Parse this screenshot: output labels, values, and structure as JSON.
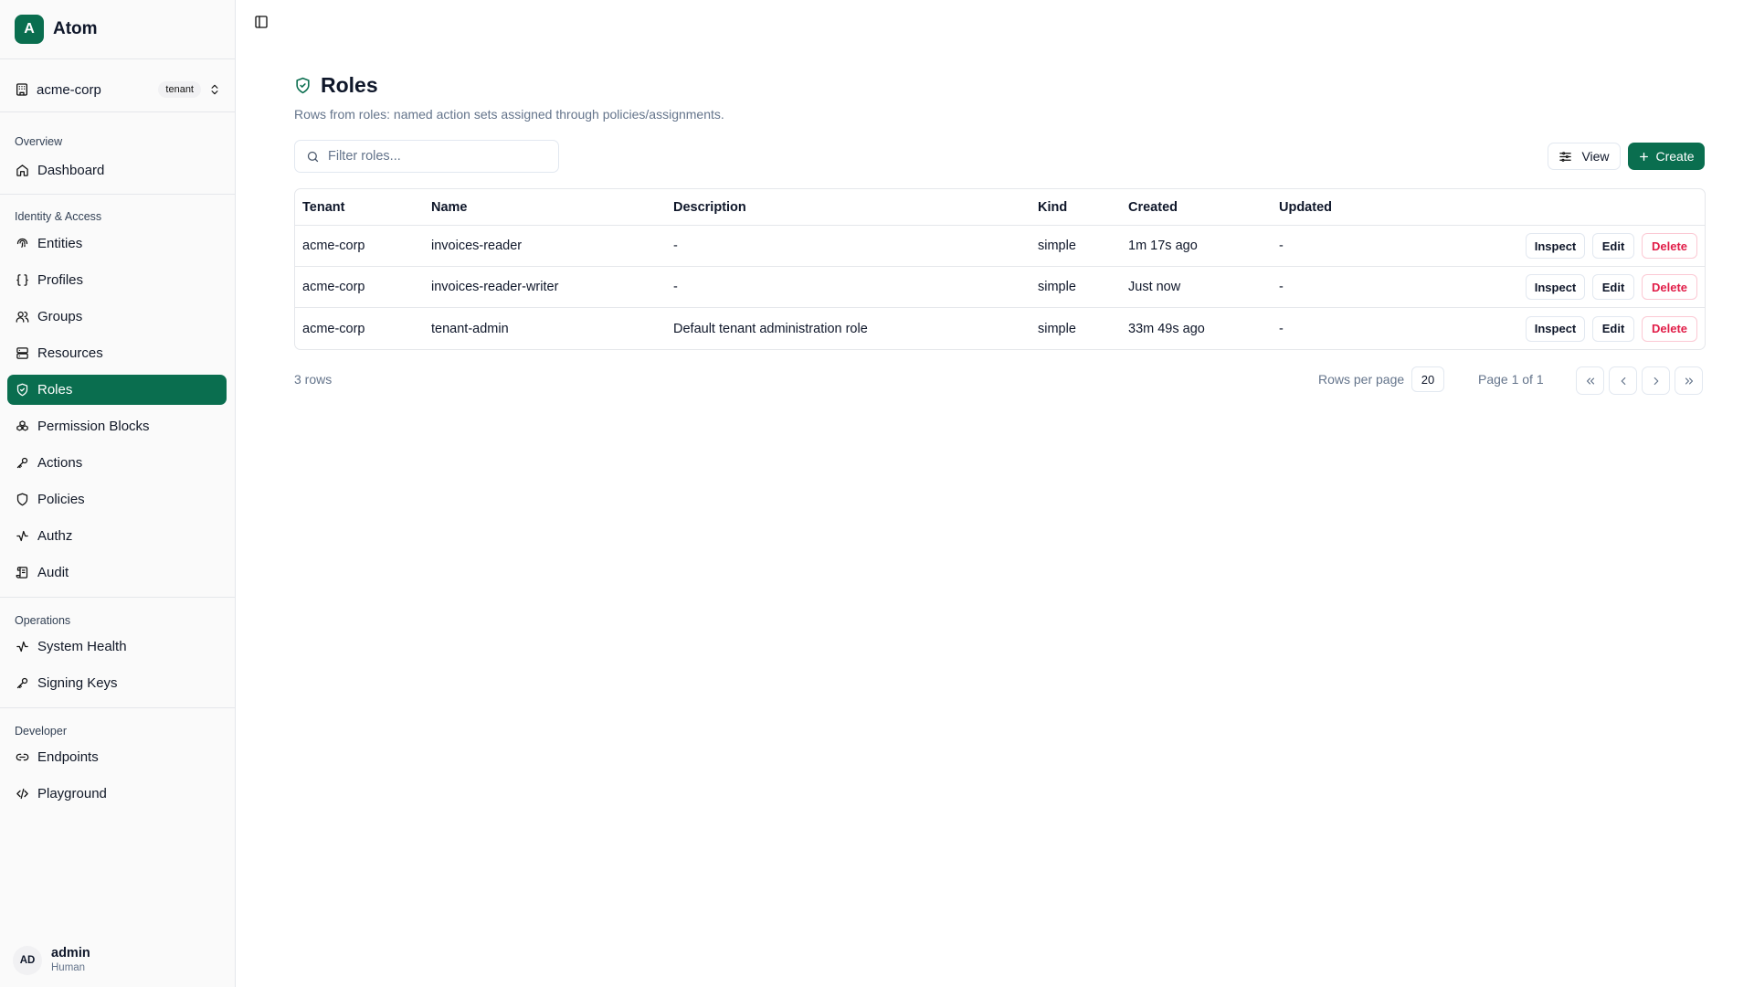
{
  "brand": {
    "logo_letter": "A",
    "name": "Atom"
  },
  "tenant": {
    "name": "acme-corp",
    "badge": "tenant"
  },
  "sidebar": {
    "sections": [
      {
        "label": "Overview",
        "items": [
          {
            "label": "Dashboard",
            "icon": "home-icon"
          }
        ]
      },
      {
        "label": "Identity & Access",
        "items": [
          {
            "label": "Entities",
            "icon": "fingerprint-icon"
          },
          {
            "label": "Profiles",
            "icon": "braces-icon"
          },
          {
            "label": "Groups",
            "icon": "users-icon"
          },
          {
            "label": "Resources",
            "icon": "server-icon"
          },
          {
            "label": "Roles",
            "icon": "shield-check-icon",
            "active": true
          },
          {
            "label": "Permission Blocks",
            "icon": "boxes-icon"
          },
          {
            "label": "Actions",
            "icon": "key-icon"
          },
          {
            "label": "Policies",
            "icon": "shield-icon"
          },
          {
            "label": "Authz",
            "icon": "activity-icon"
          },
          {
            "label": "Audit",
            "icon": "scroll-icon"
          }
        ]
      },
      {
        "label": "Operations",
        "items": [
          {
            "label": "System Health",
            "icon": "activity-icon"
          },
          {
            "label": "Signing Keys",
            "icon": "key-icon"
          }
        ]
      },
      {
        "label": "Developer",
        "items": [
          {
            "label": "Endpoints",
            "icon": "link-icon"
          },
          {
            "label": "Playground",
            "icon": "code-icon"
          }
        ]
      }
    ]
  },
  "user": {
    "initials": "AD",
    "name": "admin",
    "role": "Human"
  },
  "page": {
    "title": "Roles",
    "subtitle": "Rows from roles: named action sets assigned through policies/assignments."
  },
  "filter": {
    "placeholder": "Filter roles...",
    "value": ""
  },
  "toolbar": {
    "view_label": "View",
    "create_label": "Create"
  },
  "table": {
    "columns": [
      "Tenant",
      "Name",
      "Description",
      "Kind",
      "Created",
      "Updated"
    ],
    "rows": [
      {
        "tenant": "acme-corp",
        "name": "invoices-reader",
        "description": "-",
        "kind": "simple",
        "created": "1m 17s ago",
        "updated": "-"
      },
      {
        "tenant": "acme-corp",
        "name": "invoices-reader-writer",
        "description": "-",
        "kind": "simple",
        "created": "Just now",
        "updated": "-"
      },
      {
        "tenant": "acme-corp",
        "name": "tenant-admin",
        "description": "Default tenant administration role",
        "kind": "simple",
        "created": "33m 49s ago",
        "updated": "-"
      }
    ],
    "actions": {
      "inspect": "Inspect",
      "edit": "Edit",
      "delete": "Delete"
    }
  },
  "pagination": {
    "rows_count": "3 rows",
    "rows_per_page_label": "Rows per page",
    "rows_per_page": "20",
    "page_label": "Page 1 of 1"
  },
  "colors": {
    "accent": "#0a6e4f",
    "danger": "#e11d48",
    "border": "#e5e7eb",
    "muted": "#64748b"
  }
}
